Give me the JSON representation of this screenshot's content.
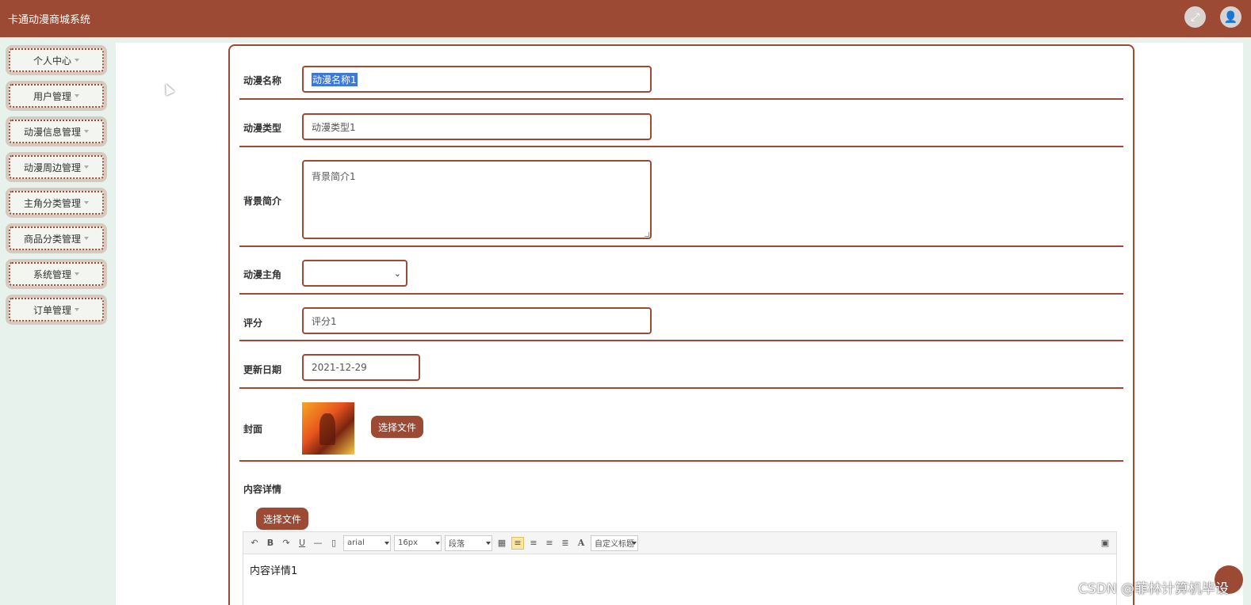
{
  "header": {
    "title": "卡通动漫商城系统"
  },
  "sidebar": {
    "items": [
      {
        "label": "个人中心"
      },
      {
        "label": "用户管理"
      },
      {
        "label": "动漫信息管理"
      },
      {
        "label": "动漫周边管理"
      },
      {
        "label": "主角分类管理"
      },
      {
        "label": "商品分类管理"
      },
      {
        "label": "系统管理"
      },
      {
        "label": "订单管理"
      }
    ]
  },
  "form": {
    "name": {
      "label": "动漫名称",
      "value": "动漫名称1"
    },
    "type": {
      "label": "动漫类型",
      "value": "动漫类型1"
    },
    "intro": {
      "label": "背景简介",
      "value": "背景简介1"
    },
    "protagonist": {
      "label": "动漫主角",
      "value": ""
    },
    "rating": {
      "label": "评分",
      "value": "评分1"
    },
    "update_date": {
      "label": "更新日期",
      "value": "2021-12-29"
    },
    "cover": {
      "label": "封面",
      "button": "选择文件"
    },
    "content": {
      "label": "内容详情",
      "button": "选择文件",
      "value": "内容详情1"
    }
  },
  "editor_toolbar": {
    "font_family": "arial",
    "font_size": "16px",
    "paragraph": "段落",
    "custom_title": "自定义标题"
  },
  "watermark": "CSDN @菲林计算机毕设",
  "colors": {
    "brand": "#9c4a33",
    "sidebar_bg": "#e8f2ec",
    "selection": "#3b78d8"
  }
}
